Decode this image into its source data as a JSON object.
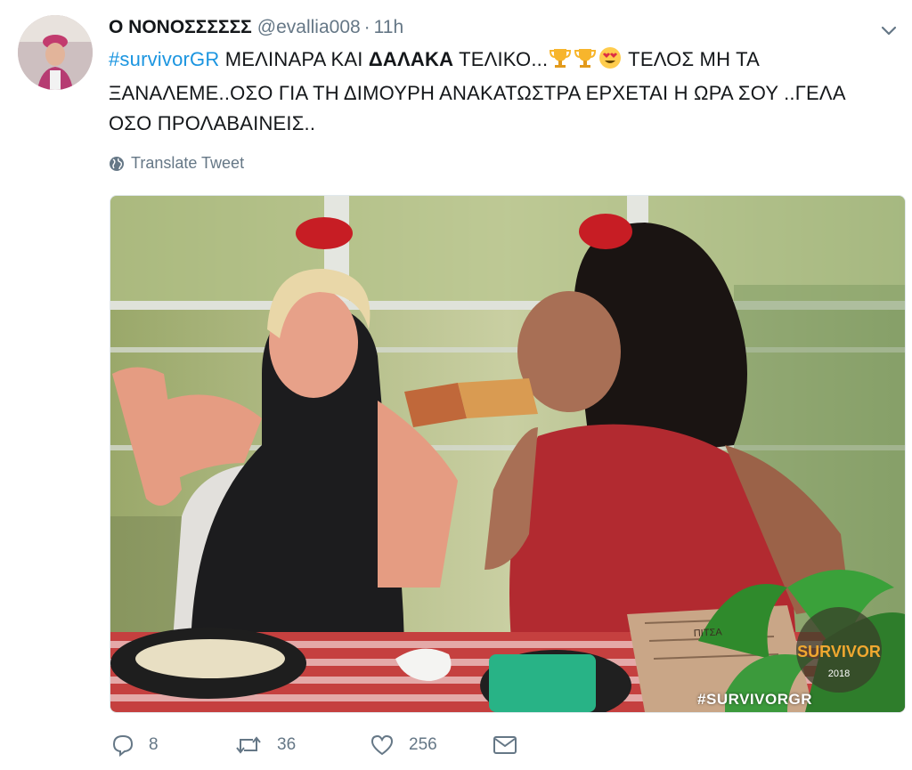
{
  "user": {
    "display_name": "Ο ΝΟΝΟΣΣΣΣΣΣ",
    "handle": "@evallia008",
    "separator": "·",
    "time": "11h",
    "avatar_icon": "profile-avatar"
  },
  "tweet": {
    "hashtag": "#survivorGR",
    "text_part1": " ΜΕΛΙΝΑΡΑ ΚΑΙ ",
    "text_bold": "ΔΑΛΑΚΑ",
    "text_part2": " ΤΕΛΙΚΟ...",
    "text_part3": " ΤΕΛΟΣ ΜΗ ΤΑ ΞΑΝΑΛΕΜΕ..ΟΣΟ ΓΙΑ ΤΗ ΔΙΜΟΥΡΗ ΑΝΑΚΑΤΩΣΤΡΑ ΕΡΧΕΤΑΙ Η ΩΡΑ ΣΟΥ ..ΓΕΛΑ ΟΣΟ ΠΡΟΛΑΒΑΙΝΕΙΣ..",
    "emojis": [
      "trophy-emoji",
      "trophy-emoji",
      "heart-eyes-emoji"
    ]
  },
  "translate": {
    "label": "Translate Tweet",
    "icon": "globe-icon"
  },
  "media": {
    "overlay_hashtag": "#SURVIVORGR",
    "logo_text": "SURVIVOR",
    "logo_year": "2018",
    "box_text": "ΠΙΤΣΑ"
  },
  "actions": {
    "reply_count": "8",
    "retweet_count": "36",
    "like_count": "256",
    "icons": [
      "reply-icon",
      "retweet-icon",
      "like-icon",
      "message-icon"
    ]
  },
  "colors": {
    "link": "#1b95e0",
    "secondary": "#657786",
    "text": "#14171a"
  }
}
